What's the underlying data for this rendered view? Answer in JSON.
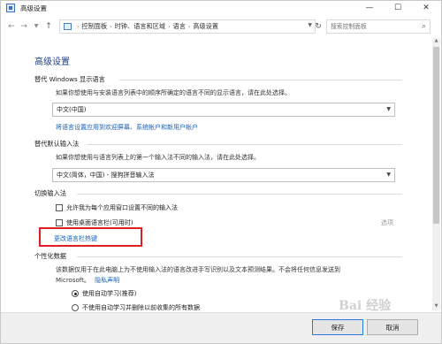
{
  "window": {
    "title": "高级设置",
    "controls": {
      "minimize": "—",
      "maximize": "☐",
      "close": "✕"
    }
  },
  "addressbar": {
    "back": "←",
    "forward": "→",
    "up": "↑",
    "breadcrumbs": [
      "控制面板",
      "时钟、语言和区域",
      "语言",
      "高级设置"
    ],
    "separator": "›",
    "search_placeholder": "搜索控制面板"
  },
  "page": {
    "title": "高级设置"
  },
  "display_language": {
    "heading": "替代 Windows 显示语言",
    "description": "如果你想使用与安装语言列表中的顺序所确定的语言不同的显示语言，请在此处选择。",
    "selected": "中文(中国)",
    "link": "将语言设置应用到欢迎屏幕、系统帐户和新用户帐户"
  },
  "default_input": {
    "heading": "替代默认输入法",
    "description": "如果你想使用与语言列表上的第一个输入法不同的输入法，请在此处选择。",
    "selected": "中文(简体，中国) - 搜狗拼音输入法"
  },
  "switch_input": {
    "heading": "切换输入法",
    "checkbox1": "允许我为每个应用窗口设置不同的输入法",
    "checkbox2": "使用桌面语言栏(可用时)",
    "options": "选项",
    "hotkeys_link": "更改语言栏热键"
  },
  "personalization": {
    "heading": "个性化数据",
    "description_line1": "该数据仅用于在此电脑上为不使用输入法的语言改进手写识别以及文本预测结果。不会将任何信息发送到",
    "description_line2": "Microsoft。",
    "privacy_link": "隐私声明",
    "radio1": "使用自动学习(推荐)",
    "radio2": "不使用自动学习并删除以前收集的所有数据"
  },
  "footer": {
    "save": "保存",
    "cancel": "取消"
  },
  "watermark": "Bai 经验"
}
